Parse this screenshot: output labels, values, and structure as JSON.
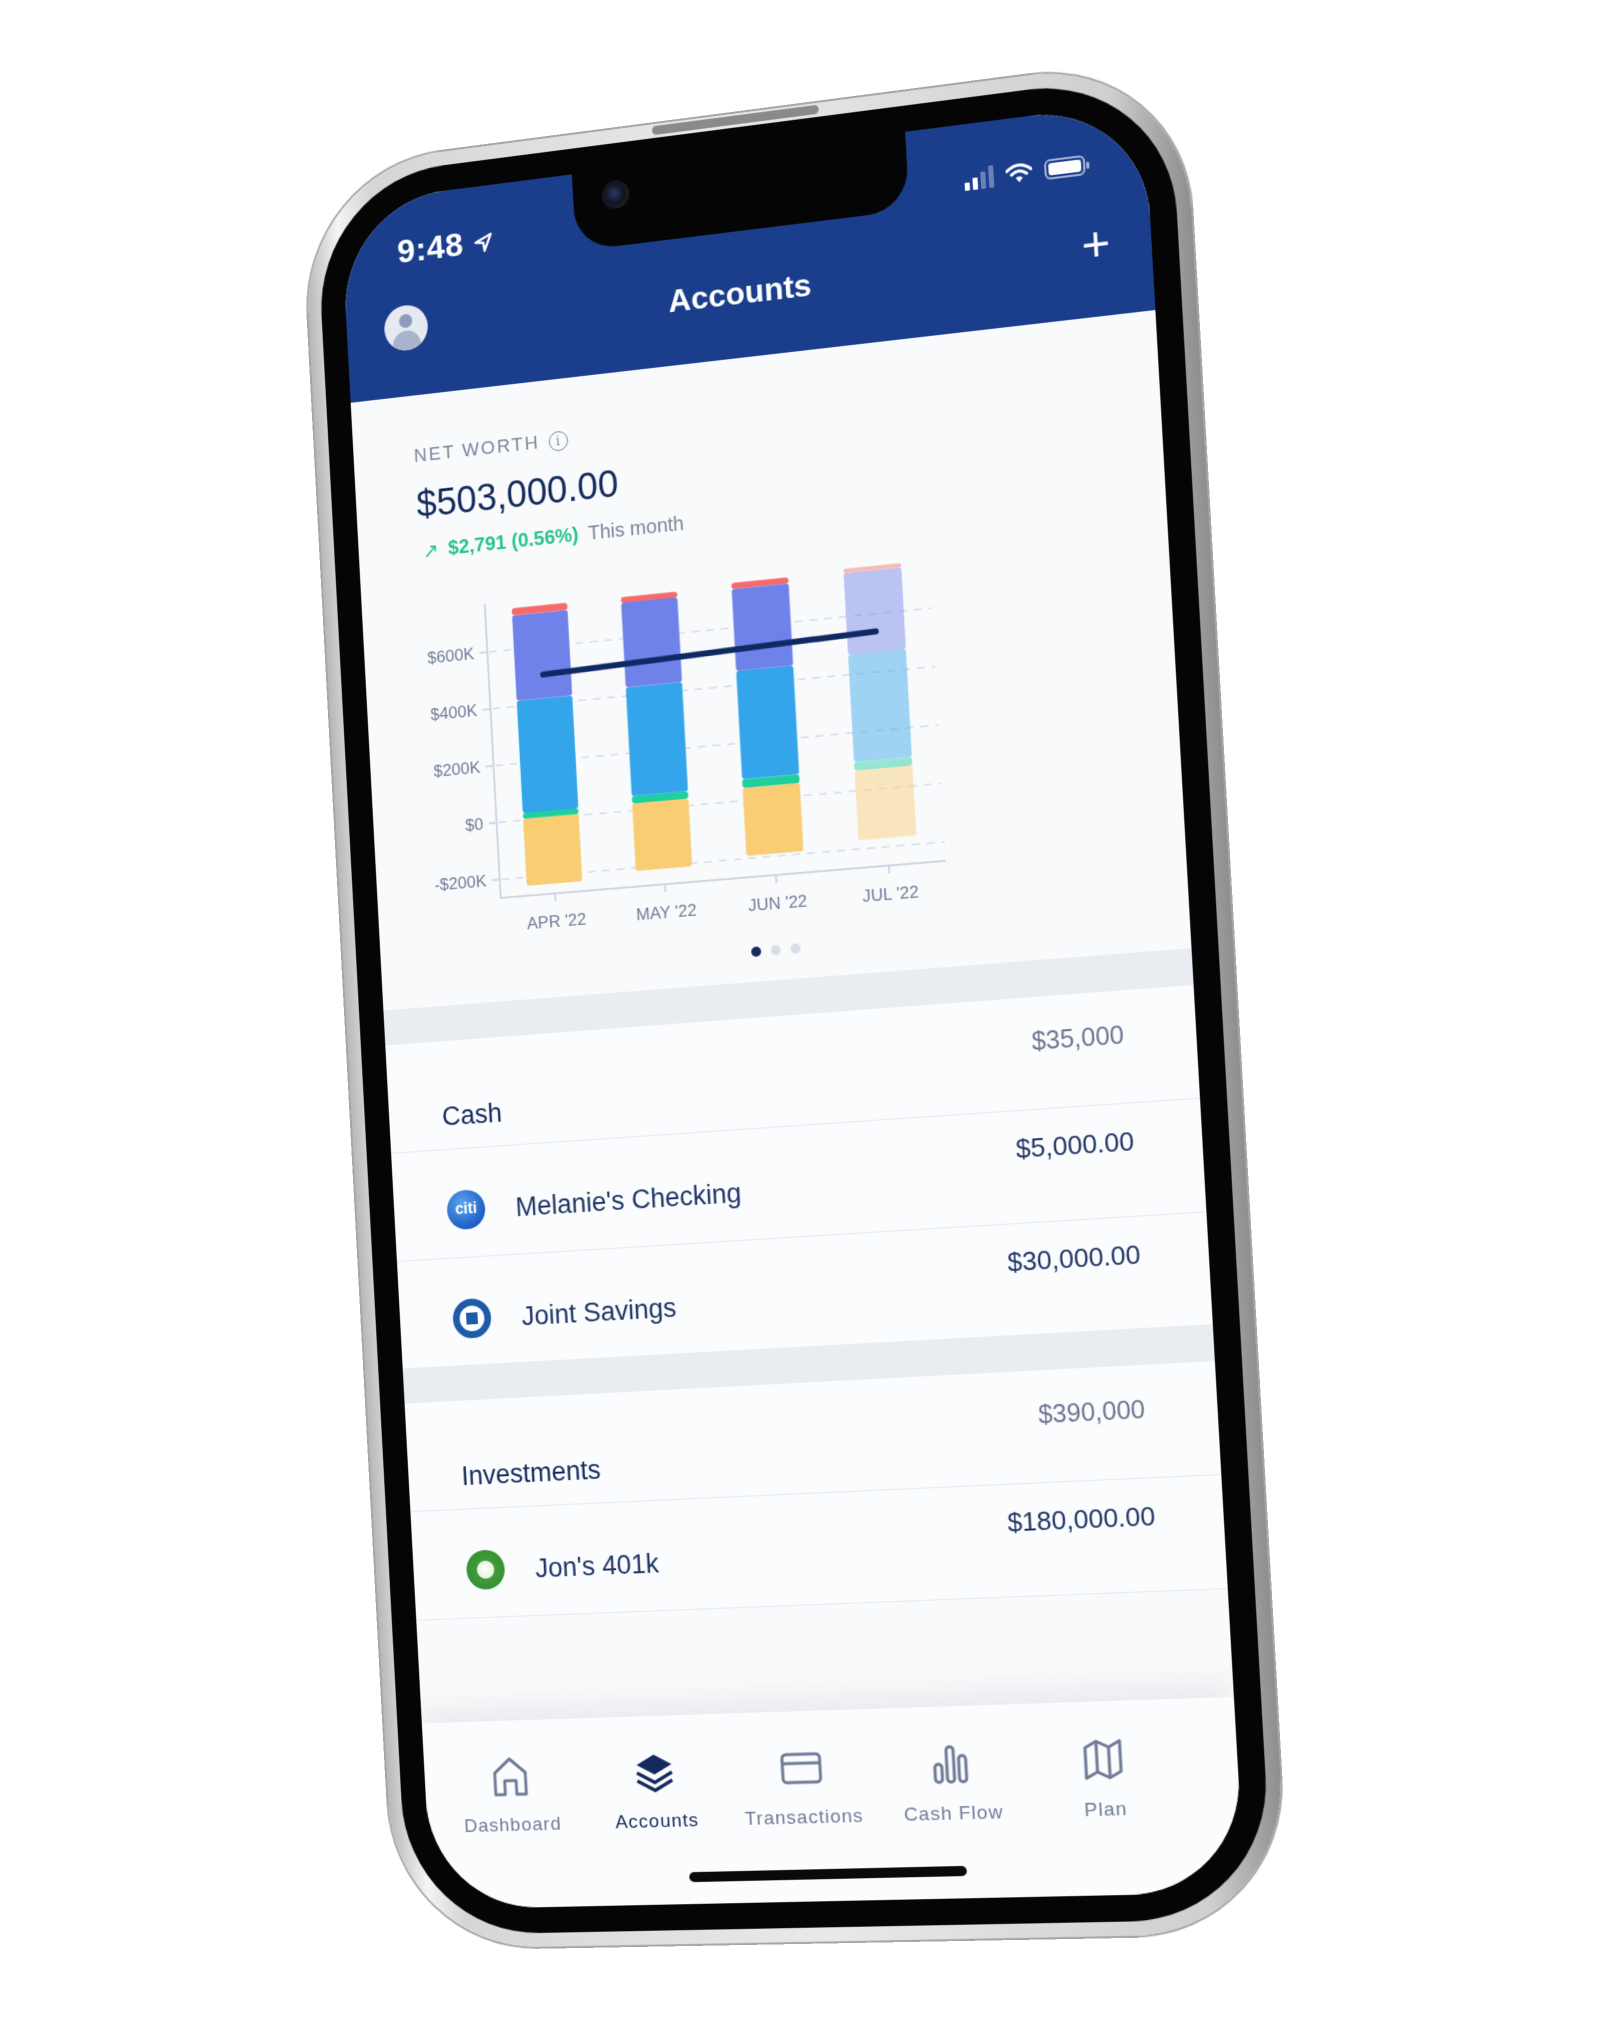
{
  "status_bar": {
    "time": "9:48",
    "location_icon": "location-arrow-icon",
    "signal_icon": "signal-icon",
    "wifi_icon": "wifi-icon",
    "battery_icon": "battery-icon"
  },
  "header": {
    "title": "Accounts",
    "avatar_icon": "user-avatar-icon",
    "add_icon": "plus-icon",
    "add_symbol": "+",
    "background": "#1a3e8c"
  },
  "net_worth": {
    "label": "NET WORTH",
    "info_icon": "info-icon",
    "value": "$503,000.00",
    "change_arrow": "↗",
    "change_amount": "$2,791 (0.56%)",
    "change_period": "This month",
    "positive_color": "#27c28f"
  },
  "chart_data": {
    "type": "bar",
    "stacked": true,
    "title": "",
    "xlabel": "",
    "ylabel": "",
    "categories": [
      "APR '22",
      "MAY '22",
      "JUN '22",
      "JUL '22"
    ],
    "y_ticks": [
      "-$200K",
      "$0",
      "$200K",
      "$400K",
      "$600K"
    ],
    "y_tick_values": [
      -200000,
      0,
      200000,
      400000,
      600000
    ],
    "ylim": [
      -230000,
      770000
    ],
    "grid": true,
    "projected_categories": [
      "JUL '22"
    ],
    "series": [
      {
        "name": "Segment 1 (yellow)",
        "color": "#f8cd74",
        "ranges": [
          [
            -230000,
            5000
          ],
          [
            -210000,
            25000
          ],
          [
            -190000,
            45000
          ],
          [
            -170000,
            70000
          ]
        ]
      },
      {
        "name": "Segment 2 (green)",
        "color": "#1fcf9c",
        "ranges": [
          [
            5000,
            25000
          ],
          [
            25000,
            50000
          ],
          [
            45000,
            75000
          ],
          [
            70000,
            100000
          ]
        ]
      },
      {
        "name": "Segment 3 (blue)",
        "color": "#34a5ea",
        "ranges": [
          [
            25000,
            420000
          ],
          [
            50000,
            430000
          ],
          [
            75000,
            450000
          ],
          [
            100000,
            470000
          ]
        ]
      },
      {
        "name": "Segment 4 (purple)",
        "color": "#6e82e9",
        "ranges": [
          [
            420000,
            720000
          ],
          [
            430000,
            725000
          ],
          [
            450000,
            735000
          ],
          [
            470000,
            750000
          ]
        ]
      },
      {
        "name": "Segment 5 (red)",
        "color": "#f56b6b",
        "ranges": [
          [
            720000,
            745000
          ],
          [
            725000,
            745000
          ],
          [
            735000,
            755000
          ],
          [
            750000,
            765000
          ]
        ]
      }
    ],
    "line_series": {
      "name": "Net worth",
      "color": "#0f2a63",
      "values": [
        503000,
        515000,
        528000,
        540000
      ]
    }
  },
  "carousel": {
    "pages": 3,
    "active_index": 0
  },
  "sections": [
    {
      "title": "Cash",
      "total": "$35,000",
      "accounts": [
        {
          "name": "Melanie's Checking",
          "amount": "$5,000.00",
          "logo": "citi-logo-icon",
          "logo_text": "citi"
        },
        {
          "name": "Joint Savings",
          "amount": "$30,000.00",
          "logo": "chase-logo-icon",
          "logo_text": ""
        }
      ]
    },
    {
      "title": "Investments",
      "total": "$390,000",
      "accounts": [
        {
          "name": "Jon's 401k",
          "amount": "$180,000.00",
          "logo": "fidelity-logo-icon",
          "logo_text": ""
        }
      ]
    }
  ],
  "tabbar": {
    "active": "Accounts",
    "items": [
      {
        "label": "Dashboard",
        "icon": "home-icon"
      },
      {
        "label": "Accounts",
        "icon": "layers-icon"
      },
      {
        "label": "Transactions",
        "icon": "credit-card-icon"
      },
      {
        "label": "Cash Flow",
        "icon": "bar-chart-icon"
      },
      {
        "label": "Plan",
        "icon": "map-icon"
      }
    ]
  }
}
